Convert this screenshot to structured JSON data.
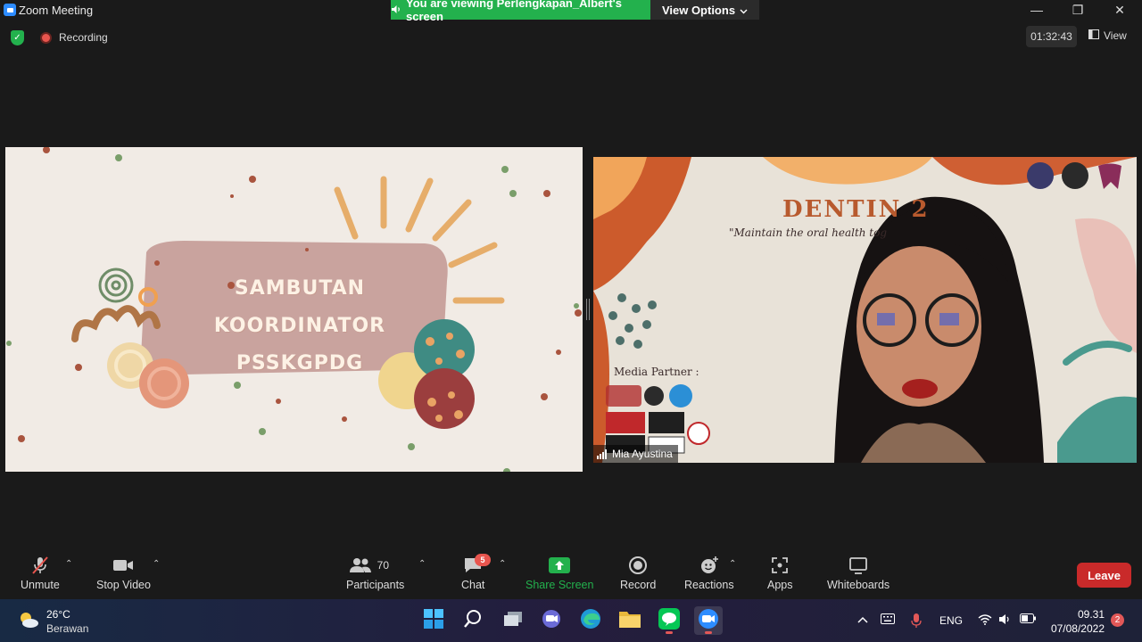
{
  "window": {
    "title": "Zoom Meeting",
    "share_banner": "You are viewing Perlengkapan_Albert's screen",
    "view_options": "View Options",
    "minimize": "—",
    "restore": "❐",
    "close": "✕"
  },
  "meeting_bar": {
    "recording": "Recording",
    "timer": "01:32:43",
    "view": "View"
  },
  "shared_slide": {
    "line1": "SAMBUTAN",
    "line2": "KOORDINATOR PSSKGPDG"
  },
  "video": {
    "heading": "DENTIN 2",
    "tagline": "\"Maintain the oral health tog",
    "media_partner": "Media Partner :",
    "participant_name": "Mia Ayustina"
  },
  "toolbar": {
    "unmute": "Unmute",
    "stop_video": "Stop Video",
    "participants": "Participants",
    "participants_count": "70",
    "chat": "Chat",
    "chat_badge": "5",
    "share_screen": "Share Screen",
    "record": "Record",
    "reactions": "Reactions",
    "apps": "Apps",
    "whiteboards": "Whiteboards",
    "leave": "Leave"
  },
  "taskbar": {
    "temperature": "26°C",
    "condition": "Berawan",
    "language": "ENG",
    "time": "09.31",
    "date": "07/08/2022",
    "notifications": "2"
  },
  "colors": {
    "share_green": "#23b14d",
    "leave_red": "#c92a2a",
    "accent_blue": "#2d8cff"
  }
}
